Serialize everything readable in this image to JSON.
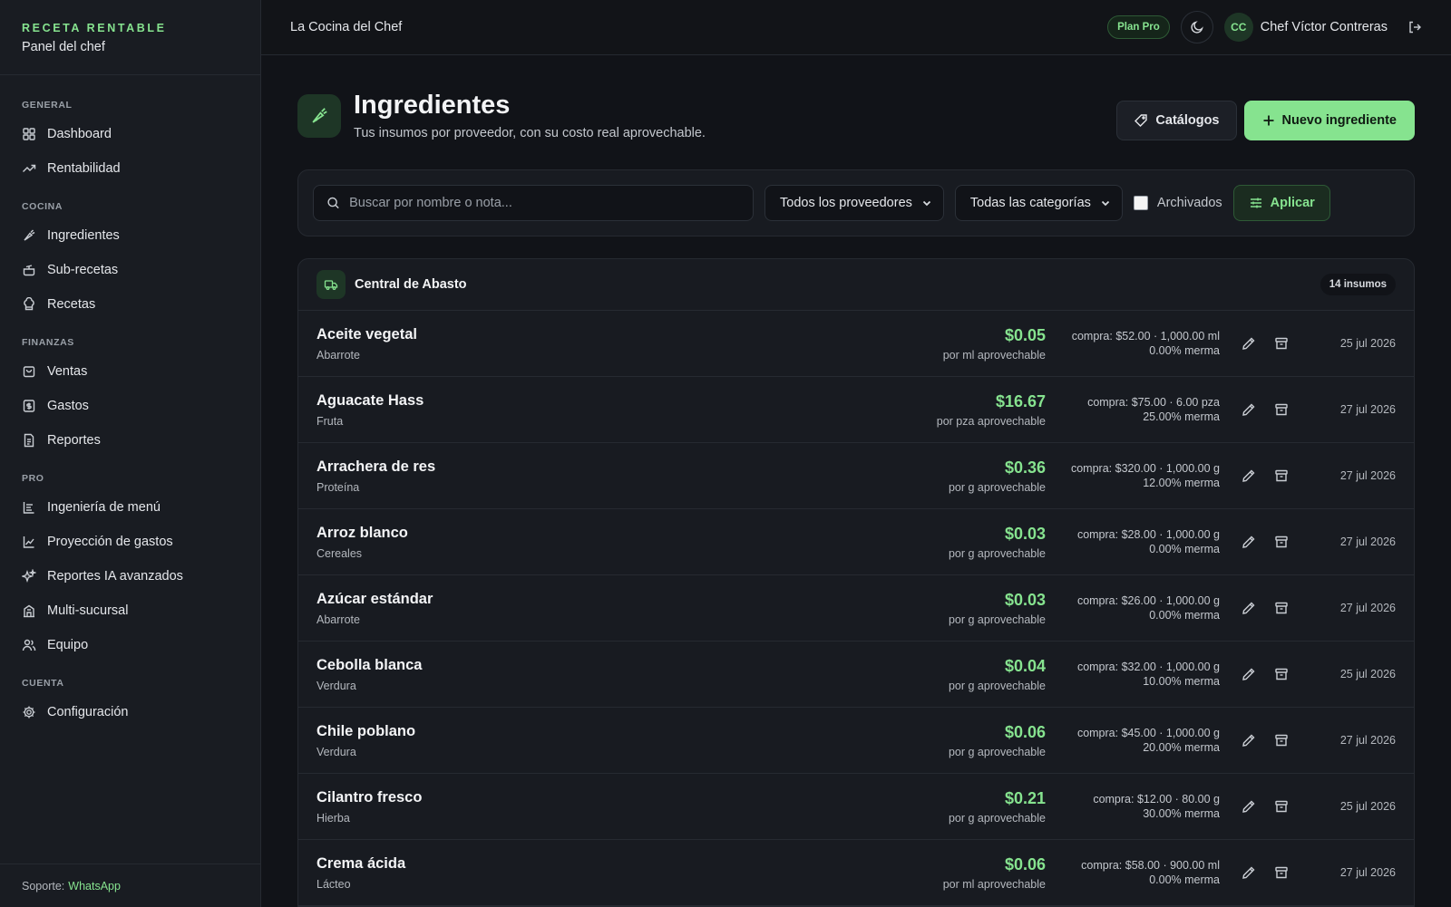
{
  "sidebar": {
    "brand_title": "RECETA RENTABLE",
    "brand_sub": "Panel del chef",
    "sections": {
      "general": "GENERAL",
      "cocina": "COCINA",
      "finanzas": "FINANZAS",
      "pro": "PRO",
      "cuenta": "CUENTA"
    },
    "items": {
      "dashboard": "Dashboard",
      "rentabilidad": "Rentabilidad",
      "ingredientes": "Ingredientes",
      "subrecetas": "Sub-recetas",
      "recetas": "Recetas",
      "ventas": "Ventas",
      "gastos": "Gastos",
      "reportes": "Reportes",
      "ingenieria": "Ingeniería de menú",
      "proyeccion": "Proyección de gastos",
      "reportes_ia": "Reportes IA avanzados",
      "multisucursal": "Multi-sucursal",
      "equipo": "Equipo",
      "configuracion": "Configuración"
    },
    "footer_label": "Soporte:",
    "footer_link": "WhatsApp"
  },
  "topbar": {
    "title": "La Cocina del Chef",
    "plan": "Plan Pro",
    "avatar_initials": "CC",
    "user_name": "Chef Víctor Contreras"
  },
  "page": {
    "title": "Ingredientes",
    "subtitle": "Tus insumos por proveedor, con su costo real aprovechable.",
    "catalogs_label": "Catálogos",
    "new_label": "Nuevo ingrediente"
  },
  "filters": {
    "search_placeholder": "Buscar por nombre o nota...",
    "providers": "Todos los proveedores",
    "categories": "Todas las categorías",
    "archived": "Archivados",
    "apply": "Aplicar"
  },
  "group": {
    "name": "Central de Abasto",
    "count": "14 insumos"
  },
  "rows": [
    {
      "name": "Aceite vegetal",
      "category": "Abarrote",
      "price": "$0.05",
      "unit": "por ml aprovechable",
      "purchase": "compra: $52.00 · 1,000.00 ml",
      "waste": "0.00% merma",
      "date": "25 jul 2026"
    },
    {
      "name": "Aguacate Hass",
      "category": "Fruta",
      "price": "$16.67",
      "unit": "por pza aprovechable",
      "purchase": "compra: $75.00 · 6.00 pza",
      "waste": "25.00% merma",
      "date": "27 jul 2026"
    },
    {
      "name": "Arrachera de res",
      "category": "Proteína",
      "price": "$0.36",
      "unit": "por g aprovechable",
      "purchase": "compra: $320.00 · 1,000.00 g",
      "waste": "12.00% merma",
      "date": "27 jul 2026"
    },
    {
      "name": "Arroz blanco",
      "category": "Cereales",
      "price": "$0.03",
      "unit": "por g aprovechable",
      "purchase": "compra: $28.00 · 1,000.00 g",
      "waste": "0.00% merma",
      "date": "27 jul 2026"
    },
    {
      "name": "Azúcar estándar",
      "category": "Abarrote",
      "price": "$0.03",
      "unit": "por g aprovechable",
      "purchase": "compra: $26.00 · 1,000.00 g",
      "waste": "0.00% merma",
      "date": "27 jul 2026"
    },
    {
      "name": "Cebolla blanca",
      "category": "Verdura",
      "price": "$0.04",
      "unit": "por g aprovechable",
      "purchase": "compra: $32.00 · 1,000.00 g",
      "waste": "10.00% merma",
      "date": "25 jul 2026"
    },
    {
      "name": "Chile poblano",
      "category": "Verdura",
      "price": "$0.06",
      "unit": "por g aprovechable",
      "purchase": "compra: $45.00 · 1,000.00 g",
      "waste": "20.00% merma",
      "date": "27 jul 2026"
    },
    {
      "name": "Cilantro fresco",
      "category": "Hierba",
      "price": "$0.21",
      "unit": "por g aprovechable",
      "purchase": "compra: $12.00 · 80.00 g",
      "waste": "30.00% merma",
      "date": "25 jul 2026"
    },
    {
      "name": "Crema ácida",
      "category": "Lácteo",
      "price": "$0.06",
      "unit": "por ml aprovechable",
      "purchase": "compra: $58.00 · 900.00 ml",
      "waste": "0.00% merma",
      "date": "27 jul 2026"
    }
  ]
}
